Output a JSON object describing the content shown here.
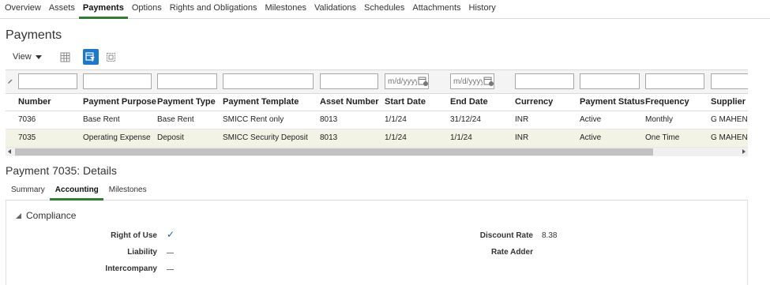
{
  "top_tabs": [
    "Overview",
    "Assets",
    "Payments",
    "Options",
    "Rights and Obligations",
    "Milestones",
    "Validations",
    "Schedules",
    "Attachments",
    "History"
  ],
  "active_top_tab": "Payments",
  "page_title": "Payments",
  "toolbar": {
    "view_label": "View"
  },
  "filters": {
    "date_placeholder": "m/d/yyyy"
  },
  "columns": [
    "Number",
    "Payment Purpose",
    "Payment Type",
    "Payment Template",
    "Asset Number",
    "Start Date",
    "End Date",
    "Currency",
    "Payment Status",
    "Frequency",
    "Supplier"
  ],
  "rows": [
    [
      "7036",
      "Base Rent",
      "Base Rent",
      "SMICC Rent only",
      "8013",
      "1/1/24",
      "31/12/24",
      "INR",
      "Active",
      "Monthly",
      "G MAHEND"
    ],
    [
      "7035",
      "Operating Expense",
      "Deposit",
      "SMICC Security Deposit",
      "8013",
      "1/1/24",
      "1/1/24",
      "INR",
      "Active",
      "One Time",
      "G MAHEND"
    ]
  ],
  "selected_row_index": 1,
  "details_title": "Payment 7035: Details",
  "sub_tabs": [
    "Summary",
    "Accounting",
    "Milestones"
  ],
  "active_sub_tab": "Accounting",
  "section": {
    "title": "Compliance",
    "fields_left": [
      {
        "label": "Right of Use",
        "value": "✓"
      },
      {
        "label": "Liability",
        "value": ""
      },
      {
        "label": "Intercompany",
        "value": ""
      }
    ],
    "fields_right": [
      {
        "label": "Discount Rate",
        "value": "8.38"
      },
      {
        "label": "Rate Adder",
        "value": ""
      }
    ]
  },
  "colors": {
    "accent_green": "#2e7d32",
    "selected_icon_blue": "#1d78c8",
    "selected_row_bg": "#f2f3e4"
  }
}
